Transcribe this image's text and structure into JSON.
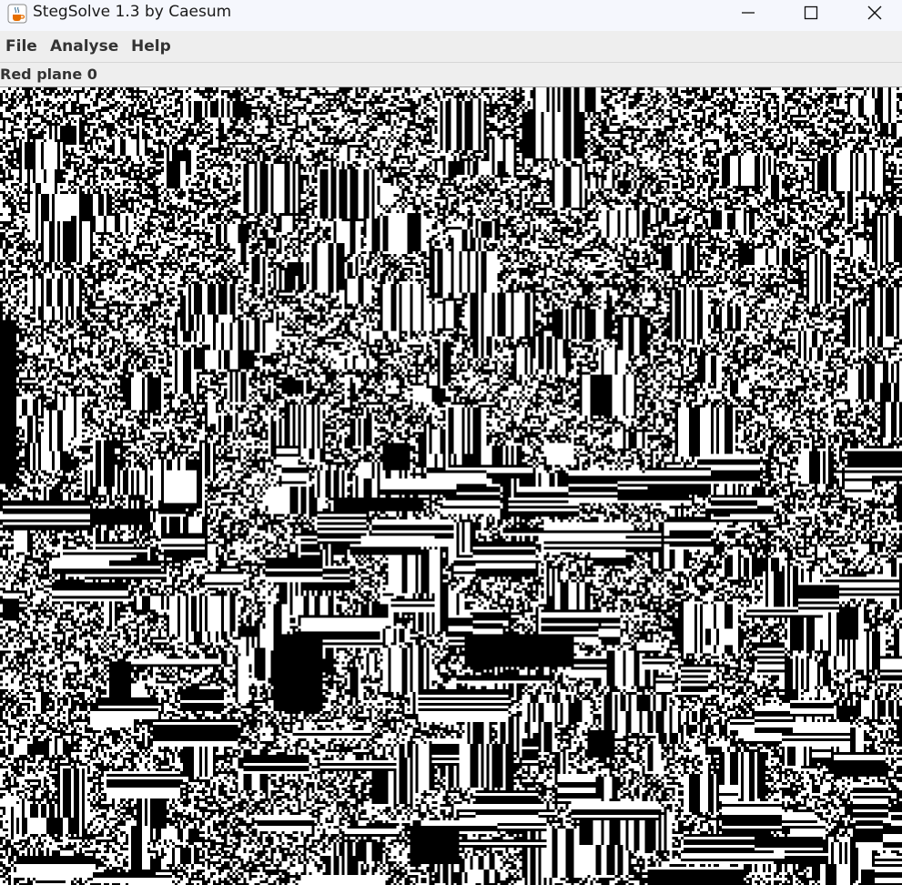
{
  "window": {
    "title": "StegSolve 1.3 by Caesum",
    "icon": "java-cup-icon",
    "controls": {
      "minimize": "minimize-icon",
      "maximize": "maximize-icon",
      "close": "close-icon"
    }
  },
  "menubar": {
    "items": [
      {
        "label": "File"
      },
      {
        "label": "Analyse"
      },
      {
        "label": "Help"
      }
    ]
  },
  "view": {
    "plane_label": "Red plane 0",
    "image": {
      "description_colors": {
        "on": "#000000",
        "off": "#ffffff"
      }
    }
  }
}
